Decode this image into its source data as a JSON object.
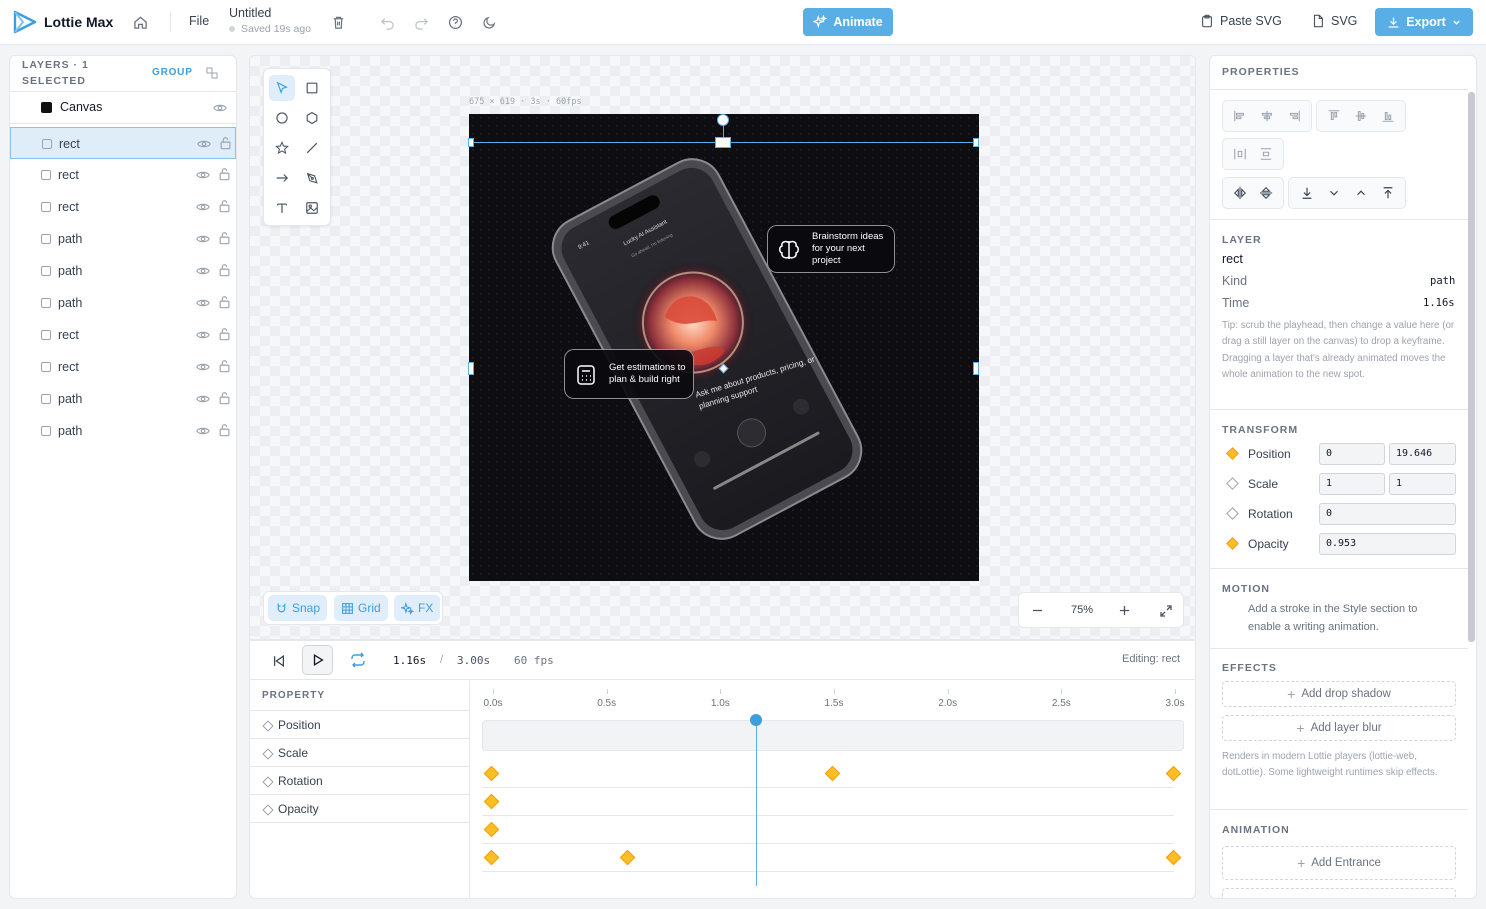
{
  "app": {
    "name": "Lottie Max",
    "file_menu": "File",
    "doc_title": "Untitled",
    "saved_status": "Saved 19s ago"
  },
  "toolbar": {
    "animate_label": "Animate",
    "paste_svg_label": "Paste SVG",
    "svg_label": "SVG",
    "export_label": "Export"
  },
  "layers": {
    "header": "LAYERS · 1",
    "header2": "SELECTED",
    "group_label": "GROUP",
    "canvas_label": "Canvas",
    "items": [
      {
        "name": "rect",
        "selected": true
      },
      {
        "name": "rect"
      },
      {
        "name": "rect"
      },
      {
        "name": "path"
      },
      {
        "name": "path"
      },
      {
        "name": "path"
      },
      {
        "name": "rect"
      },
      {
        "name": "rect"
      },
      {
        "name": "path"
      },
      {
        "name": "path"
      }
    ]
  },
  "canvas": {
    "info": "675 × 619 · 3s · 60fps",
    "bubble_right": "Brainstorm ideas for your next project",
    "bubble_left": "Get estimations to plan & build right",
    "phone_caption": "Ask me about products, pricing, or planning support",
    "phone_header": "Lucky AI Assistant",
    "phone_sub": "Go ahead, I'm listening",
    "phone_time": "9:41",
    "snap_label": "Snap",
    "grid_label": "Grid",
    "fx_label": "FX",
    "zoom": "75%"
  },
  "timeline": {
    "current_time": "1.16s",
    "separator": "/",
    "total_time": "3.00s",
    "fps": "60 fps",
    "editing": "Editing: rect",
    "property_header": "PROPERTY",
    "ticks": [
      "0.0s",
      "0.5s",
      "1.0s",
      "1.5s",
      "2.0s",
      "2.5s",
      "3.0s"
    ],
    "duration": 3.0,
    "playhead": 1.16,
    "rows": [
      {
        "name": "Position",
        "keyframes": [
          0.0,
          1.5,
          3.0
        ]
      },
      {
        "name": "Scale",
        "keyframes": [
          0.0
        ]
      },
      {
        "name": "Rotation",
        "keyframes": [
          0.0
        ]
      },
      {
        "name": "Opacity",
        "keyframes": [
          0.0,
          0.6,
          3.0
        ]
      }
    ]
  },
  "properties": {
    "header": "PROPERTIES",
    "layer_section": "LAYER",
    "layer_name": "rect",
    "kind_label": "Kind",
    "kind_value": "path",
    "time_label": "Time",
    "time_value": "1.16s",
    "tip": "Tip: scrub the playhead, then change a value here (or drag a still layer on the canvas) to drop a keyframe. Dragging a layer that's already animated moves the whole animation to the new spot.",
    "transform_section": "TRANSFORM",
    "position_label": "Position",
    "position_x": "0",
    "position_y": "19.646",
    "scale_label": "Scale",
    "scale_x": "1",
    "scale_y": "1",
    "rotation_label": "Rotation",
    "rotation_value": "0",
    "opacity_label": "Opacity",
    "opacity_value": "0.953",
    "motion_section": "MOTION",
    "motion_text": "Add a stroke in the Style section to enable a writing animation.",
    "effects_section": "EFFECTS",
    "add_drop_shadow": "Add drop shadow",
    "add_layer_blur": "Add layer blur",
    "effects_note": "Renders in modern Lottie players (lottie-web, dotLottie). Some lightweight runtimes skip effects.",
    "animation_section": "ANIMATION",
    "add_entrance": "Add Entrance"
  },
  "colors": {
    "accent": "#3b9ee0",
    "keyframe": "#fbbf24",
    "canvas_bg": "#0d0d12"
  }
}
